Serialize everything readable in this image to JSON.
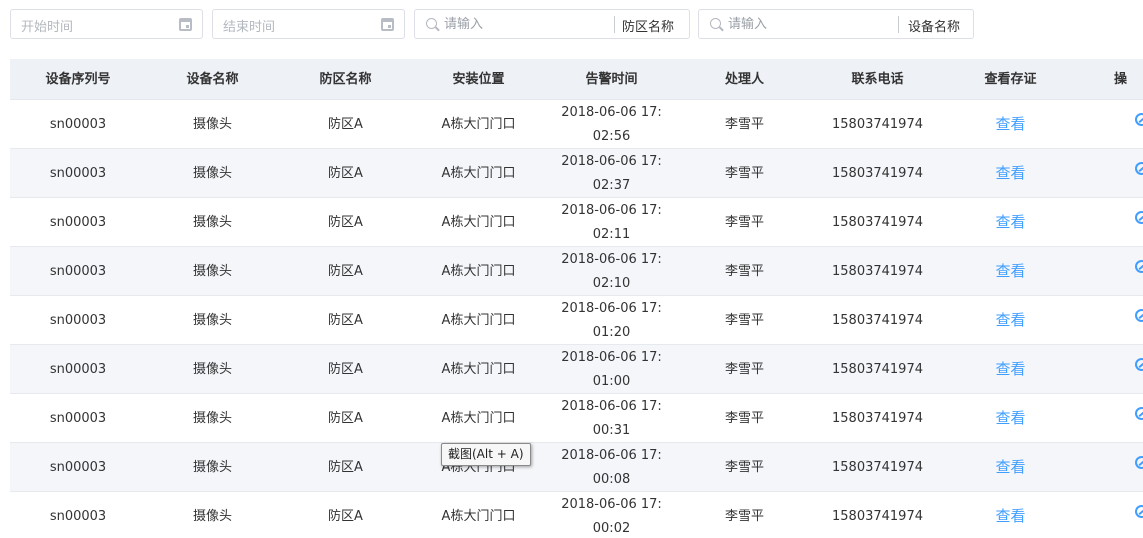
{
  "filters": {
    "start_placeholder": "开始时间",
    "end_placeholder": "结束时间",
    "zone_search_placeholder": "请输入",
    "zone_search_append": "防区名称",
    "device_search_placeholder": "请输入",
    "device_search_append": "设备名称"
  },
  "table": {
    "headers": [
      "设备序列号",
      "设备名称",
      "防区名称",
      "安装位置",
      "告警时间",
      "处理人",
      "联系电话",
      "查看存证",
      "操"
    ],
    "rows": [
      {
        "serial": "sn00003",
        "device": "摄像头",
        "zone": "防区A",
        "location": "A栋大门门口",
        "time_line1": "2018-06-06 17:",
        "time_line2": "02:56",
        "handler": "李雪平",
        "phone": "15803741974",
        "view": "查看"
      },
      {
        "serial": "sn00003",
        "device": "摄像头",
        "zone": "防区A",
        "location": "A栋大门门口",
        "time_line1": "2018-06-06 17:",
        "time_line2": "02:37",
        "handler": "李雪平",
        "phone": "15803741974",
        "view": "查看"
      },
      {
        "serial": "sn00003",
        "device": "摄像头",
        "zone": "防区A",
        "location": "A栋大门门口",
        "time_line1": "2018-06-06 17:",
        "time_line2": "02:11",
        "handler": "李雪平",
        "phone": "15803741974",
        "view": "查看"
      },
      {
        "serial": "sn00003",
        "device": "摄像头",
        "zone": "防区A",
        "location": "A栋大门门口",
        "time_line1": "2018-06-06 17:",
        "time_line2": "02:10",
        "handler": "李雪平",
        "phone": "15803741974",
        "view": "查看"
      },
      {
        "serial": "sn00003",
        "device": "摄像头",
        "zone": "防区A",
        "location": "A栋大门门口",
        "time_line1": "2018-06-06 17:",
        "time_line2": "01:20",
        "handler": "李雪平",
        "phone": "15803741974",
        "view": "查看"
      },
      {
        "serial": "sn00003",
        "device": "摄像头",
        "zone": "防区A",
        "location": "A栋大门门口",
        "time_line1": "2018-06-06 17:",
        "time_line2": "01:00",
        "handler": "李雪平",
        "phone": "15803741974",
        "view": "查看"
      },
      {
        "serial": "sn00003",
        "device": "摄像头",
        "zone": "防区A",
        "location": "A栋大门门口",
        "time_line1": "2018-06-06 17:",
        "time_line2": "00:31",
        "handler": "李雪平",
        "phone": "15803741974",
        "view": "查看"
      },
      {
        "serial": "sn00003",
        "device": "摄像头",
        "zone": "防区A",
        "location": "A栋大门门口",
        "time_line1": "2018-06-06 17:",
        "time_line2": "00:08",
        "handler": "李雪平",
        "phone": "15803741974",
        "view": "查看"
      },
      {
        "serial": "sn00003",
        "device": "摄像头",
        "zone": "防区A",
        "location": "A栋大门门口",
        "time_line1": "2018-06-06 17:",
        "time_line2": "00:02",
        "handler": "李雪平",
        "phone": "15803741974",
        "view": "查看"
      }
    ],
    "operation_icon": "eye-off-icon"
  },
  "tooltip": {
    "text": "截图(Alt + A)"
  }
}
